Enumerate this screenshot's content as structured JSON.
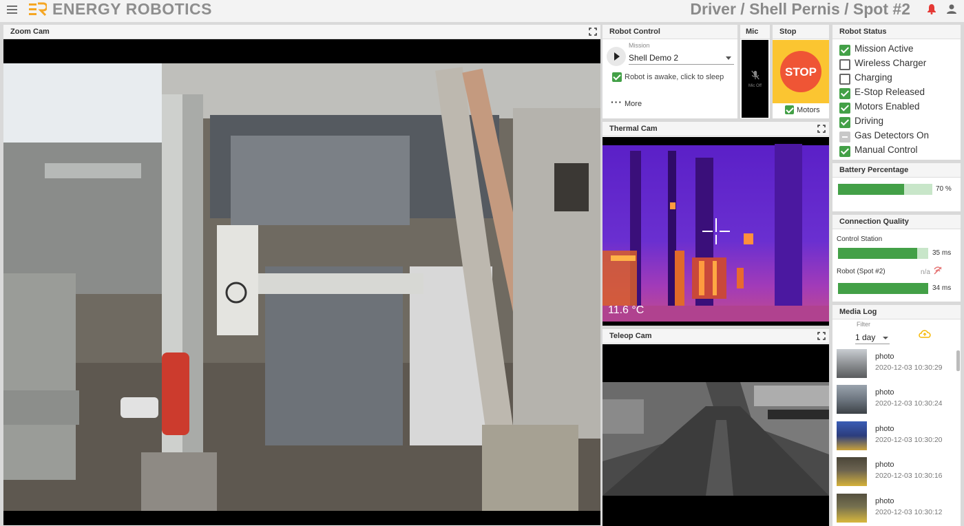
{
  "header": {
    "brand": "ENERGY ROBOTICS",
    "breadcrumb": "Driver / Shell Pernis /  Spot #2",
    "brand_color": "#f5a623",
    "alert_color": "#e53935"
  },
  "zoom_cam": {
    "title": "Zoom Cam"
  },
  "robot_control": {
    "title": "Robot Control",
    "mission_label": "Mission",
    "mission_value": "Shell Demo 2",
    "awake_label": "Robot is awake, click to sleep",
    "more_label": "More"
  },
  "mic": {
    "title": "Mic",
    "status": "Mic Off"
  },
  "stop": {
    "title": "Stop",
    "button_label": "STOP",
    "motors_label": "Motors",
    "stop_color": "#ef5535",
    "bg_color": "#fbc531"
  },
  "robot_status": {
    "title": "Robot Status",
    "items": [
      {
        "label": "Mission Active",
        "state": "checked"
      },
      {
        "label": "Wireless Charger",
        "state": "unchecked"
      },
      {
        "label": "Charging",
        "state": "unchecked"
      },
      {
        "label": "E-Stop Released",
        "state": "checked"
      },
      {
        "label": "Motors Enabled",
        "state": "checked"
      },
      {
        "label": "Driving",
        "state": "checked"
      },
      {
        "label": "Gas Detectors On",
        "state": "disabled"
      },
      {
        "label": "Manual Control",
        "state": "checked"
      }
    ]
  },
  "thermal_cam": {
    "title": "Thermal Cam",
    "temperature": "11.6 °C"
  },
  "teleop_cam": {
    "title": "Teleop Cam"
  },
  "battery": {
    "title": "Battery Percentage",
    "value_label": "70 %",
    "fraction": 0.7
  },
  "connection": {
    "title": "Connection Quality",
    "control_station_label": "Control Station",
    "control_station_value": "35 ms",
    "control_station_fraction": 0.88,
    "robot_label": "Robot (Spot #2)",
    "robot_na": "n/a",
    "robot_value": "34 ms",
    "robot_fraction": 1.0
  },
  "media_log": {
    "title": "Media Log",
    "filter_label": "Filter",
    "filter_value": "1 day",
    "items": [
      {
        "type": "photo",
        "time": "2020-12-03 10:30:29"
      },
      {
        "type": "photo",
        "time": "2020-12-03 10:30:24"
      },
      {
        "type": "photo",
        "time": "2020-12-03 10:30:20"
      },
      {
        "type": "photo",
        "time": "2020-12-03 10:30:16"
      },
      {
        "type": "photo",
        "time": "2020-12-03 10:30:12"
      }
    ]
  }
}
